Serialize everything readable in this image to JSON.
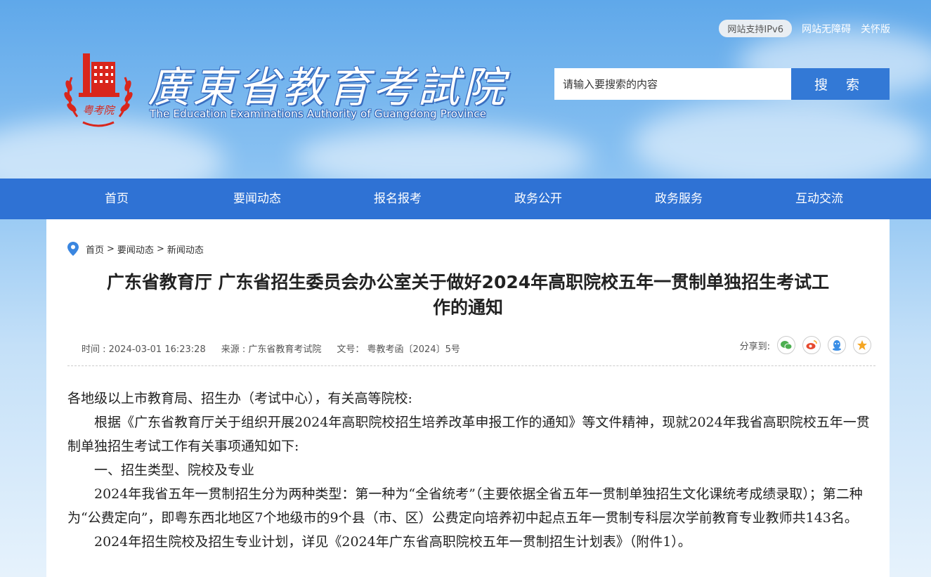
{
  "top_links": {
    "ipv6": "网站支持IPv6",
    "accessible": "网站无障碍",
    "care": "关怀版"
  },
  "logo": {
    "title": "廣東省教育考試院",
    "subtitle_en": "The Education Examinations Authority of Guangdong Province",
    "emblem_text": "粤考院"
  },
  "search": {
    "placeholder": "请输入要搜索的内容",
    "button": "搜 索"
  },
  "nav": [
    "首页",
    "要闻动态",
    "报名报考",
    "政务公开",
    "政务服务",
    "互动交流"
  ],
  "breadcrumb": [
    "首页",
    "要闻动态",
    "新闻动态"
  ],
  "breadcrumb_sep": ">",
  "article": {
    "title_line1": "广东省教育厅 广东省招生委员会办公室关于做好2024年高职院校五年一贯制单独招生考试工",
    "title_line2": "作的通知",
    "time": "时间 : 2024-03-01 16:23:28",
    "source": "来源 : 广东省教育考试院",
    "doc_no": "文号： 粤教考函〔2024〕5号",
    "share_label": "分享到:",
    "paragraphs": [
      "各地级以上市教育局、招生办（考试中心），有关高等院校:",
      "根据《广东省教育厅关于组织开展2024年高职院校招生培养改革申报工作的通知》等文件精神，现就2024年我省高职院校五年一贯制单独招生考试工作有关事项通知如下:",
      "一、招生类型、院校及专业",
      "2024年我省五年一贯制招生分为两种类型：第一种为“全省统考”（主要依据全省五年一贯制单独招生文化课统考成绩录取）；第二种为“公费定向”，即粤东西北地区7个地级市的9个县（市、区）公费定向培养初中起点五年一贯制专科层次学前教育专业教师共143名。",
      "2024年招生院校及招生专业计划，详见《2024年广东省高职院校五年一贯制招生计划表》（附件1）。"
    ]
  },
  "colors": {
    "nav_bg": "#2f72d4",
    "search_btn": "#3379d6",
    "emblem_red": "#d9261c",
    "wechat": "#4caf50",
    "weibo": "#e6492e",
    "qq": "#3a8ee6",
    "qzone": "#f5a623"
  },
  "share_icons": [
    "wechat-icon",
    "weibo-icon",
    "qq-icon",
    "qzone-icon"
  ]
}
